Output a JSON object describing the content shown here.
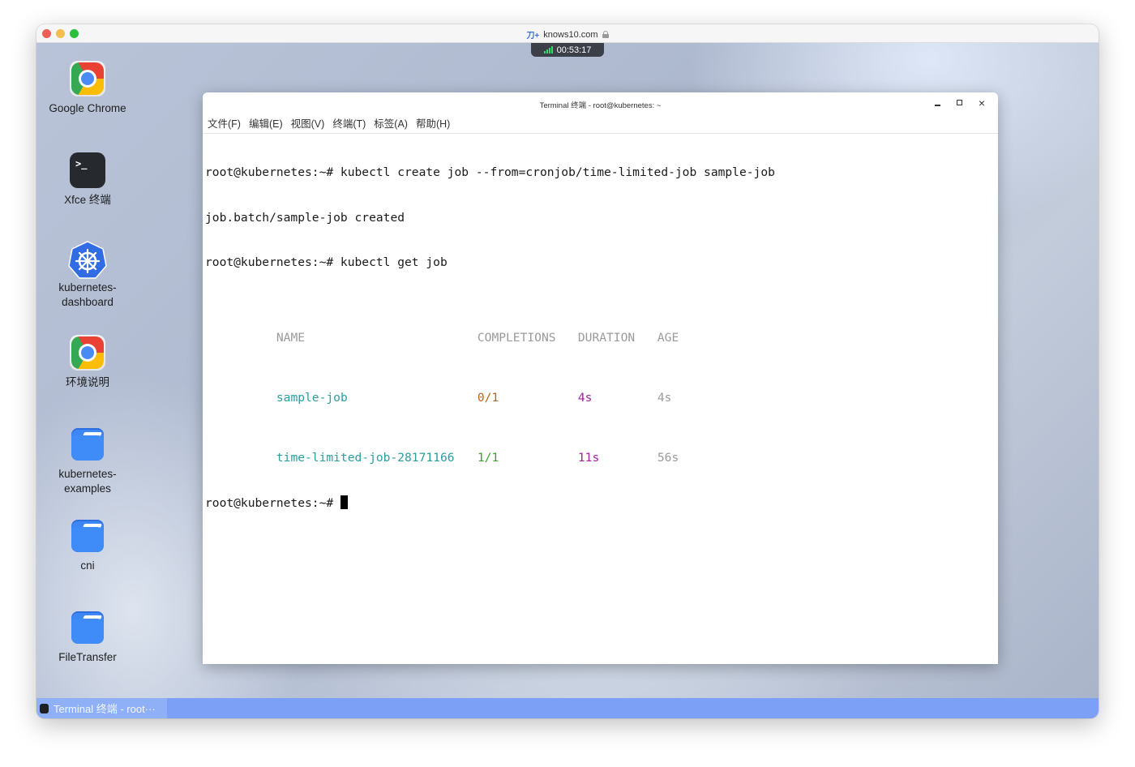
{
  "browser": {
    "site_icon": "site-logo-icon",
    "site_label": "knows10.com",
    "lock_icon": "lock-icon",
    "session_timer": "00:53:17",
    "signal_icon": "signal-bars-icon"
  },
  "desktop": {
    "icons": [
      {
        "label": "Google Chrome",
        "icon": "chrome-icon"
      },
      {
        "label": "Xfce 终端",
        "icon": "terminal-icon"
      },
      {
        "label": "kubernetes-\ndashboard",
        "icon": "kubernetes-icon"
      },
      {
        "label": "环境说明",
        "icon": "chrome-icon"
      },
      {
        "label": "kubernetes-\nexamples",
        "icon": "folder-icon"
      },
      {
        "label": "cni",
        "icon": "folder-icon"
      },
      {
        "label": "FileTransfer",
        "icon": "folder-icon"
      }
    ],
    "terminal_icon_glyph": ">_"
  },
  "terminal": {
    "title": "Terminal 终端 - root@kubernetes: ~",
    "window_buttons": {
      "minimize": "minimize-icon",
      "maximize": "maximize-icon",
      "close": "×"
    },
    "menu": [
      "文件(F)",
      "编辑(E)",
      "视图(V)",
      "终端(T)",
      "标签(A)",
      "帮助(H)"
    ],
    "lines": {
      "l1": "root@kubernetes:~# kubectl create job --from=cronjob/time-limited-job sample-job",
      "l2": "job.batch/sample-job created",
      "l3": "root@kubernetes:~# kubectl get job",
      "prompt": "root@kubernetes:~# "
    },
    "table": {
      "headers": [
        "NAME",
        "COMPLETIONS",
        "DURATION",
        "AGE"
      ],
      "rows": [
        {
          "name": "sample-job",
          "completions": "0/1",
          "duration": "4s",
          "age": "4s"
        },
        {
          "name": "time-limited-job-28171166",
          "completions": "1/1",
          "duration": "11s",
          "age": "56s"
        }
      ]
    },
    "colors": {
      "header": "#9a9a9a",
      "name": "#2a9d9d",
      "completions_incomplete": "#b5651d",
      "completions_complete": "#3aa02a",
      "duration": "#a020a0",
      "age": "#9a9a9a"
    }
  },
  "taskbar": {
    "task_label": "Terminal 终端 - root···"
  }
}
